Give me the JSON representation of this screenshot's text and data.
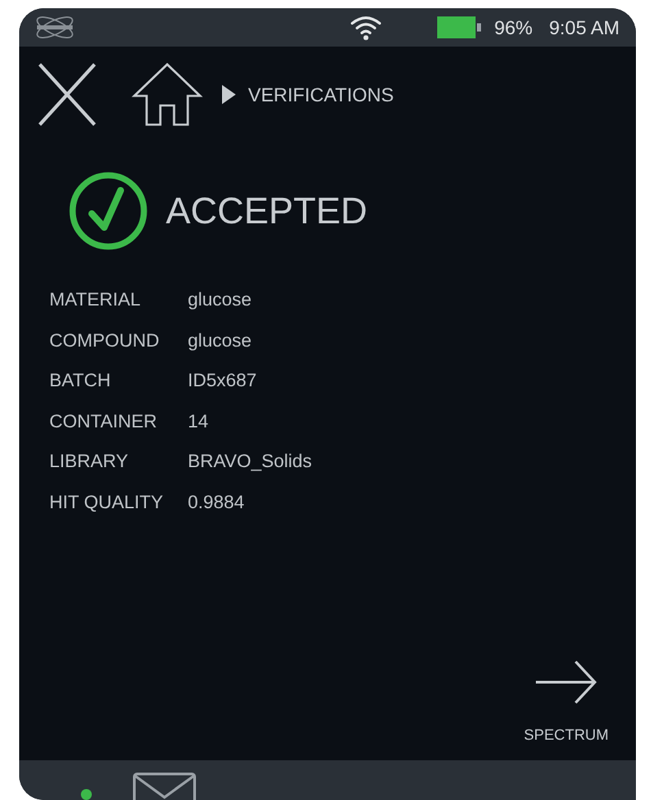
{
  "status_bar": {
    "battery": "96%",
    "time": "9:05 AM"
  },
  "breadcrumb": {
    "label": "VERIFICATIONS"
  },
  "result": {
    "kind": "accepted",
    "status": "ACCEPTED"
  },
  "fields": [
    {
      "label": "MATERIAL",
      "value": "glucose"
    },
    {
      "label": "COMPOUND",
      "value": "glucose"
    },
    {
      "label": "BATCH",
      "value": "ID5x687"
    },
    {
      "label": "CONTAINER",
      "value": "14"
    },
    {
      "label": "LIBRARY",
      "value": "BRAVO_Solids"
    },
    {
      "label": "HIT QUALITY",
      "value": "0.9884"
    }
  ],
  "next": {
    "label": "SPECTRUM"
  }
}
